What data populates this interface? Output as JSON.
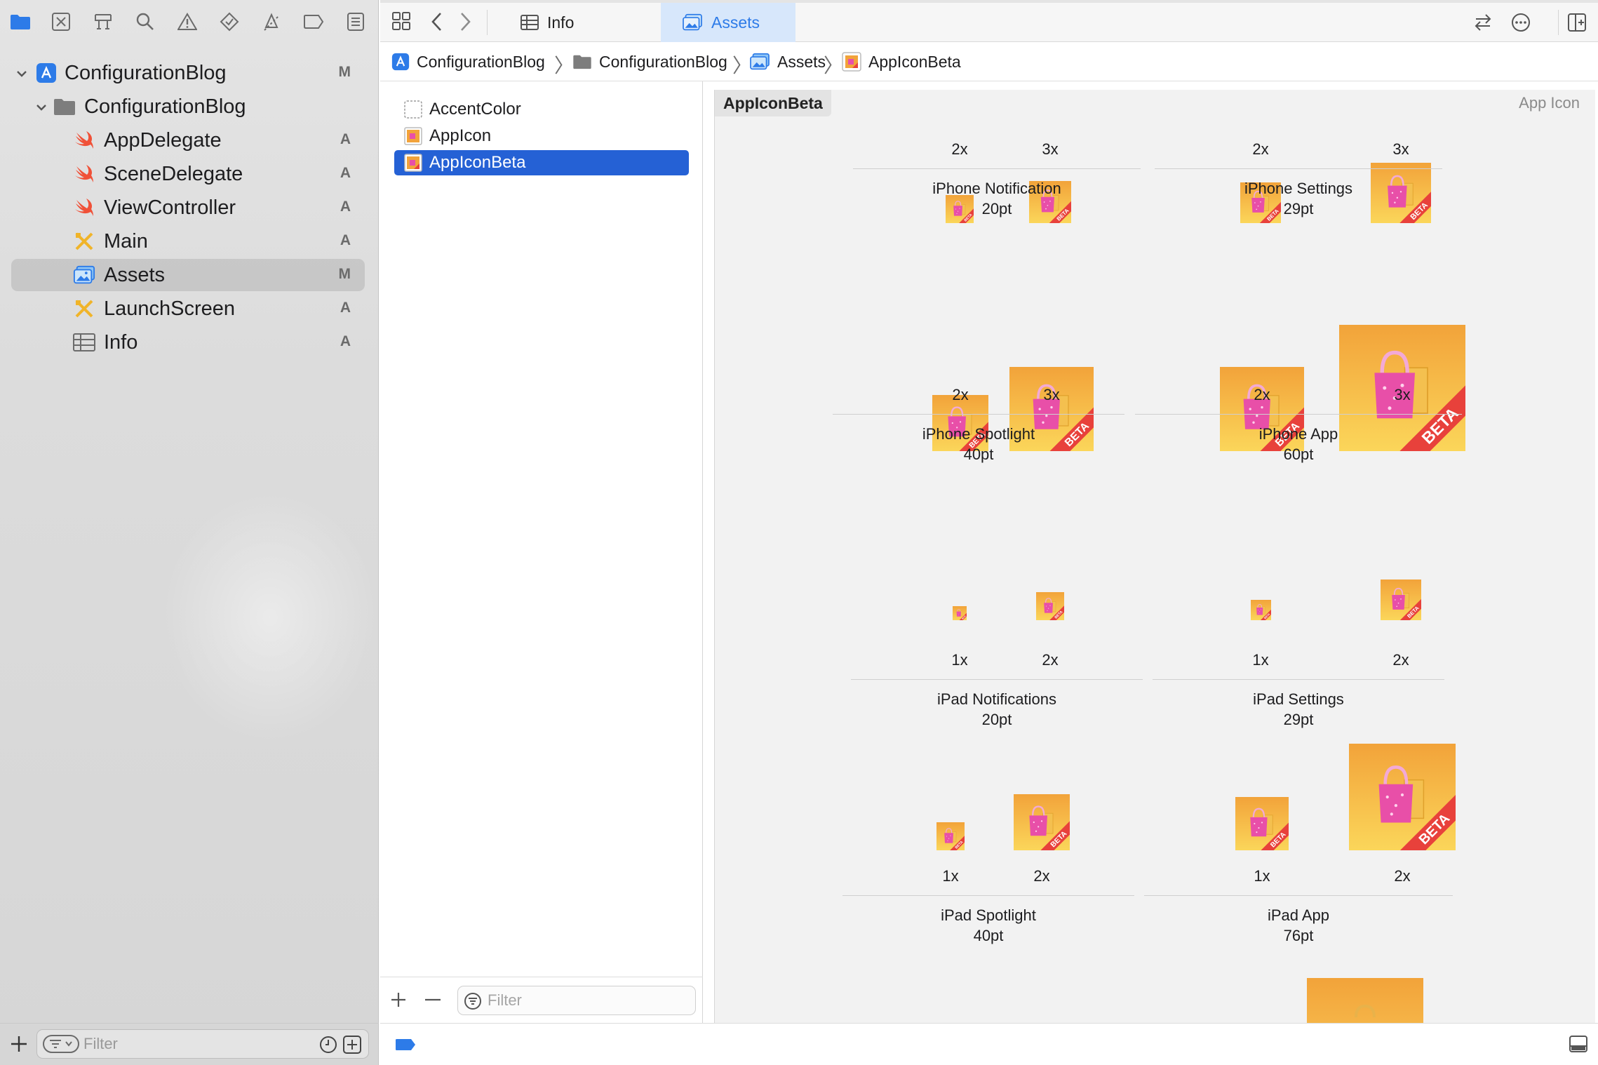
{
  "navigator": {
    "toolbar_icons": [
      "folder-icon",
      "source-control-icon",
      "symbol-icon",
      "find-icon",
      "issue-icon",
      "test-icon",
      "debug-icon",
      "breakpoint-icon",
      "report-icon"
    ],
    "tree": [
      {
        "label": "ConfigurationBlog",
        "status": "M",
        "icon": "xcode-project-icon",
        "level": 0,
        "expanded": true
      },
      {
        "label": "ConfigurationBlog",
        "status": "",
        "icon": "folder-icon",
        "level": 1,
        "expanded": true
      },
      {
        "label": "AppDelegate",
        "status": "A",
        "icon": "swift-file-icon",
        "level": 2
      },
      {
        "label": "SceneDelegate",
        "status": "A",
        "icon": "swift-file-icon",
        "level": 2
      },
      {
        "label": "ViewController",
        "status": "A",
        "icon": "swift-file-icon",
        "level": 2
      },
      {
        "label": "Main",
        "status": "A",
        "icon": "storyboard-icon",
        "level": 2
      },
      {
        "label": "Assets",
        "status": "M",
        "icon": "asset-catalog-icon",
        "level": 2,
        "selected": true
      },
      {
        "label": "LaunchScreen",
        "status": "A",
        "icon": "storyboard-icon",
        "level": 2
      },
      {
        "label": "Info",
        "status": "A",
        "icon": "plist-icon",
        "level": 2
      }
    ],
    "filter_placeholder": "Filter"
  },
  "tabs": [
    {
      "label": "Info",
      "active": false
    },
    {
      "label": "Assets",
      "active": true
    }
  ],
  "breadcrumb": [
    "ConfigurationBlog",
    "ConfigurationBlog",
    "Assets",
    "AppIconBeta"
  ],
  "asset_list": {
    "items": [
      {
        "label": "AccentColor",
        "selected": false
      },
      {
        "label": "AppIcon",
        "selected": false
      },
      {
        "label": "AppIconBeta",
        "selected": true
      }
    ],
    "filter_placeholder": "Filter"
  },
  "iconset": {
    "name": "AppIconBeta",
    "kind": "App Icon",
    "badge_text": "BETA",
    "colors": {
      "orange": "#f2a33a",
      "yellow": "#fbd65a",
      "bag": "#e84fa8",
      "ribbon": "#e8413b"
    },
    "groups": [
      {
        "title": "iPhone Notification",
        "size": "20pt",
        "slots": [
          {
            "scale": "2x"
          },
          {
            "scale": "3x"
          }
        ]
      },
      {
        "title": "iPhone Settings",
        "size": "29pt",
        "slots": [
          {
            "scale": "2x"
          },
          {
            "scale": "3x"
          }
        ]
      },
      {
        "title": "iPhone Spotlight",
        "size": "40pt",
        "slots": [
          {
            "scale": "2x"
          },
          {
            "scale": "3x"
          }
        ]
      },
      {
        "title": "iPhone App",
        "size": "60pt",
        "slots": [
          {
            "scale": "2x"
          },
          {
            "scale": "3x"
          }
        ]
      },
      {
        "title": "iPad Notifications",
        "size": "20pt",
        "slots": [
          {
            "scale": "1x"
          },
          {
            "scale": "2x"
          }
        ]
      },
      {
        "title": "iPad Settings",
        "size": "29pt",
        "slots": [
          {
            "scale": "1x"
          },
          {
            "scale": "2x"
          }
        ]
      },
      {
        "title": "iPad Spotlight",
        "size": "40pt",
        "slots": [
          {
            "scale": "1x"
          },
          {
            "scale": "2x"
          }
        ]
      },
      {
        "title": "iPad App",
        "size": "76pt",
        "slots": [
          {
            "scale": "1x"
          },
          {
            "scale": "2x"
          }
        ]
      }
    ]
  }
}
